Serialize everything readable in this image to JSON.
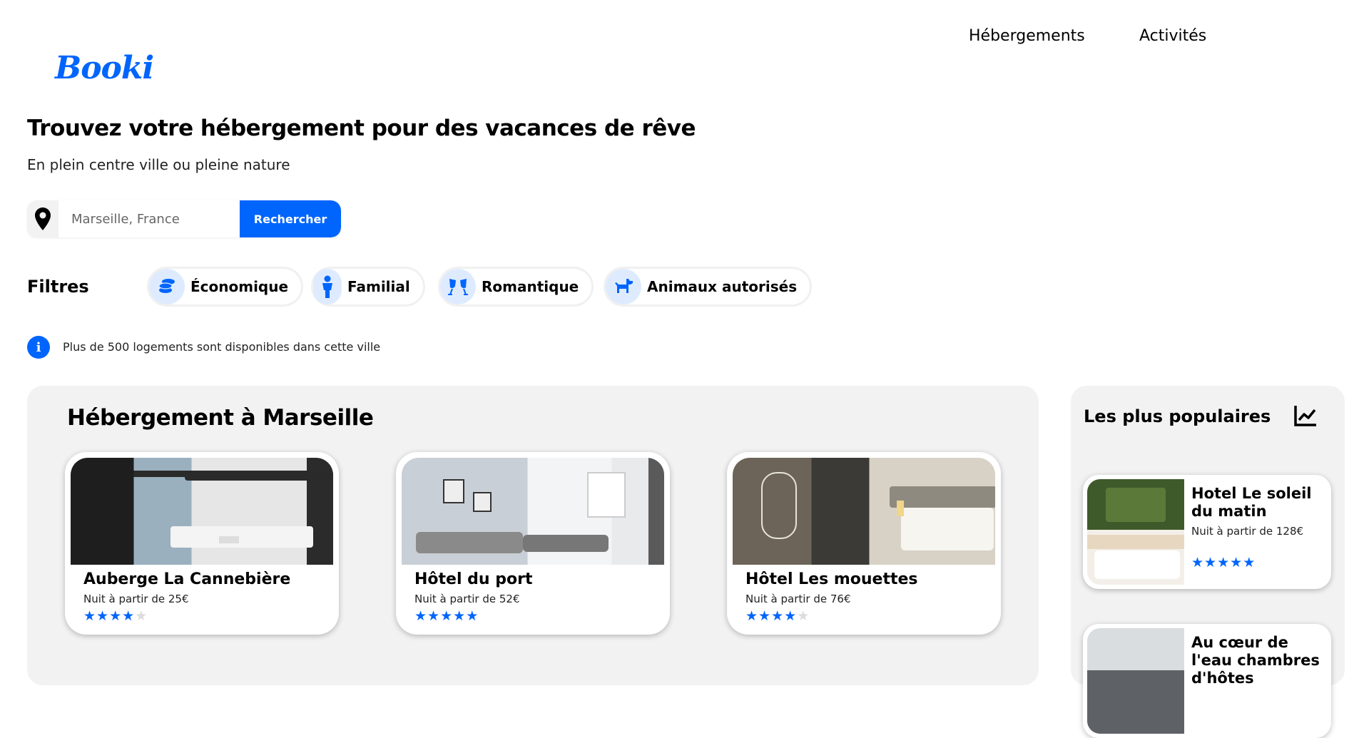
{
  "header": {
    "logo": "Booki",
    "nav": [
      "Hébergements",
      "Activités"
    ]
  },
  "hero": {
    "title": "Trouvez votre hébergement pour des vacances de rêve",
    "subtitle": "En plein centre ville ou pleine nature",
    "search": {
      "placeholder": "Marseille, France",
      "button": "Rechercher"
    }
  },
  "filters": {
    "label": "Filtres",
    "items": [
      {
        "label": "Économique",
        "icon": "money-coins-icon"
      },
      {
        "label": "Familial",
        "icon": "child-icon"
      },
      {
        "label": "Romantique",
        "icon": "glasses-cheers-icon"
      },
      {
        "label": "Animaux autorisés",
        "icon": "dog-icon"
      }
    ]
  },
  "info": "Plus de 500 logements sont disponibles dans cette ville",
  "main": {
    "title": "Hébergement à Marseille",
    "cards": [
      {
        "name": "Auberge La Cannebière",
        "price": "Nuit à partir de 25€",
        "rating": 4
      },
      {
        "name": "Hôtel du port",
        "price": "Nuit à partir de 52€",
        "rating": 5
      },
      {
        "name": "Hôtel Les mouettes",
        "price": "Nuit à partir de 76€",
        "rating": 4
      }
    ]
  },
  "popular": {
    "title": "Les plus populaires",
    "icon": "chart-line-icon",
    "cards": [
      {
        "name": "Hotel Le soleil du matin",
        "price": "Nuit à partir de 128€",
        "rating": 5
      },
      {
        "name": "Au cœur de l'eau chambres d'hôtes",
        "price": "",
        "rating": 0
      }
    ]
  },
  "colors": {
    "accent": "#0065fc",
    "accent_light": "#deebff",
    "panel": "#f2f2f2"
  }
}
